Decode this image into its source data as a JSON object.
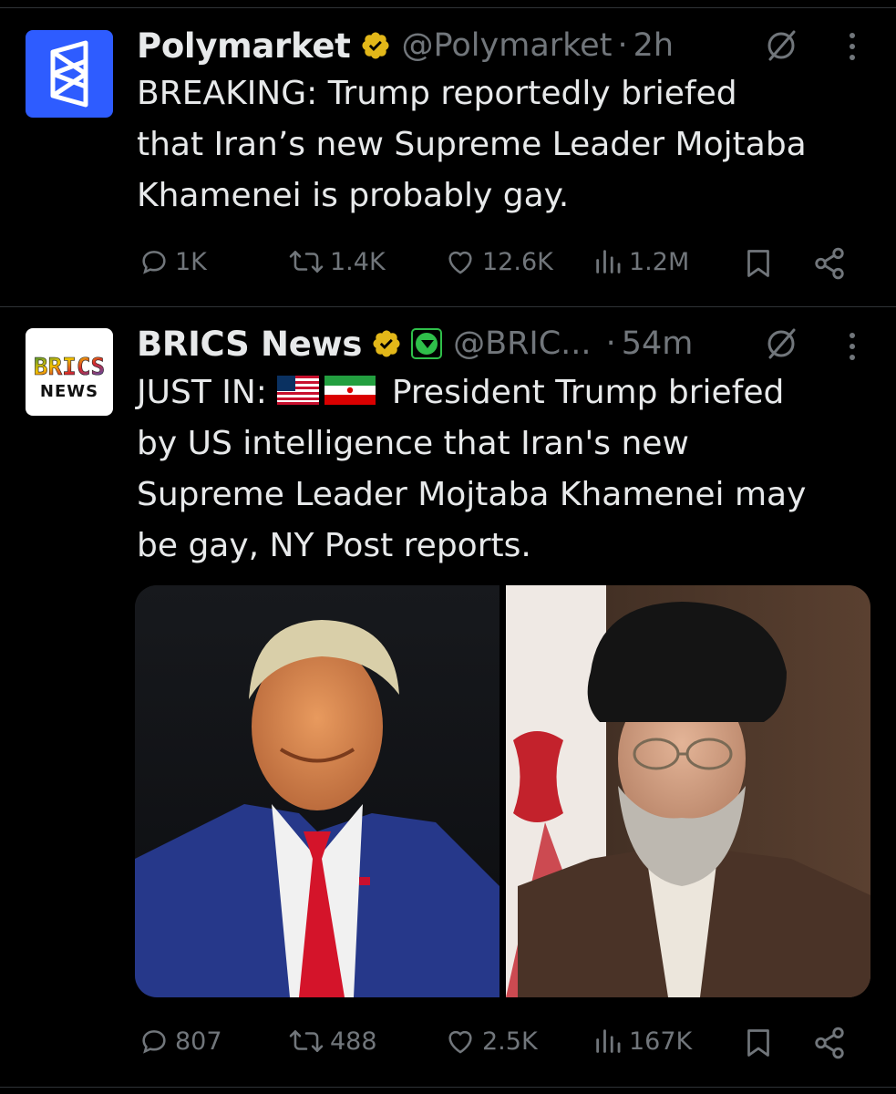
{
  "tweets": [
    {
      "name": "Polymarket",
      "handle": "@Polymarket",
      "time": "2h",
      "text_lines": [
        "BREAKING: Trump reportedly briefed",
        "that Iran’s new Supreme Leader Mojtaba",
        "Khamenei is probably gay."
      ],
      "stats": {
        "replies": "1K",
        "reposts": "1.4K",
        "likes": "12.6K",
        "views": "1.2M"
      }
    },
    {
      "name": "BRICS News",
      "handle": "@BRIC...",
      "time": "54m",
      "avatar_text": [
        "BRICS",
        "NEWS"
      ],
      "text_prefix": "JUST IN:",
      "text_line1_rest": "President Trump briefed",
      "text_lines": [
        "by US intelligence that Iran's new",
        "Supreme Leader Mojtaba Khamenei may",
        "be gay, NY Post reports."
      ],
      "stats": {
        "replies": "807",
        "reposts": "488",
        "likes": "2.5K",
        "views": "167K"
      }
    }
  ],
  "separator": "·",
  "colors": {
    "background": "#000000",
    "text": "#e7e9ea",
    "muted": "#71767b",
    "verified_gold": "#e2b719",
    "polymarket_blue": "#2e5cff",
    "divider": "#2f3336"
  },
  "icons": [
    "verified-badge-icon",
    "grok-icon",
    "more-icon",
    "reply-icon",
    "repost-icon",
    "like-icon",
    "views-icon",
    "bookmark-icon",
    "share-icon",
    "us-flag-icon",
    "iran-flag-icon"
  ]
}
